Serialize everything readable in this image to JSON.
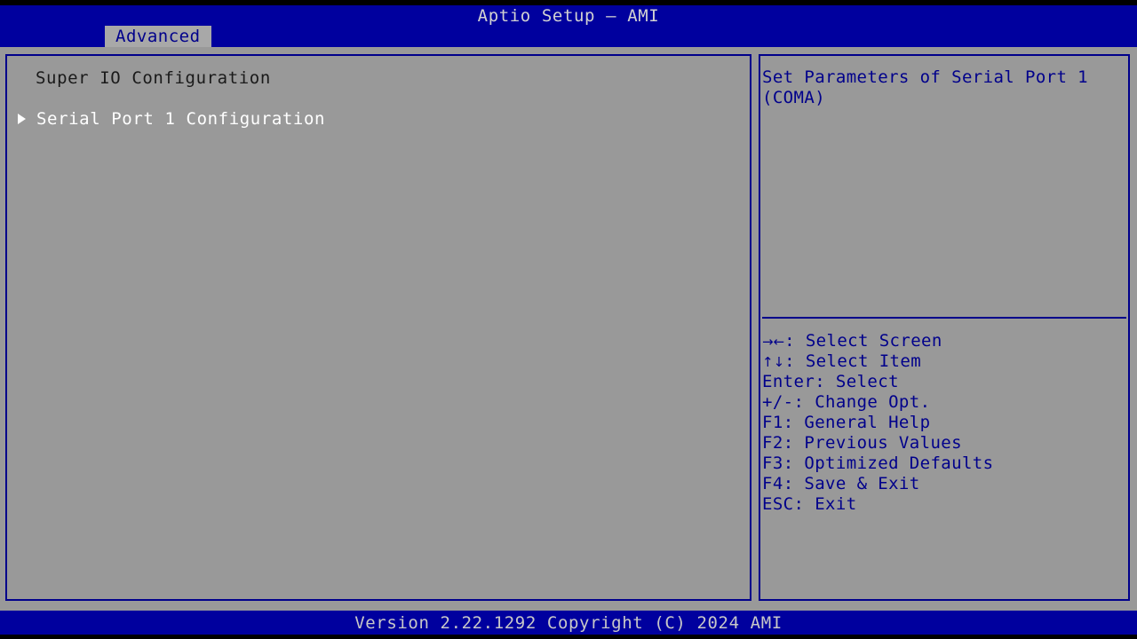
{
  "header": {
    "title": "Aptio Setup – AMI",
    "tabs": [
      {
        "label": "Advanced",
        "active": true
      }
    ]
  },
  "main": {
    "section_heading": "Super IO Configuration",
    "items": [
      {
        "label": "Serial Port 1 Configuration",
        "marker": "submenu-arrow-icon",
        "selected": true
      }
    ]
  },
  "help": {
    "text": "Set Parameters of Serial Port 1 (COMA)"
  },
  "keys": [
    {
      "glyph": "→←",
      "key": "",
      "separator": ": ",
      "action": "Select Screen",
      "line": "→←: Select Screen"
    },
    {
      "glyph": "↑↓",
      "key": "",
      "separator": ": ",
      "action": "Select Item",
      "line": "↑↓: Select Item"
    },
    {
      "glyph": "",
      "key": "Enter",
      "separator": ": ",
      "action": "Select",
      "line": "Enter: Select"
    },
    {
      "glyph": "",
      "key": "+/-",
      "separator": ": ",
      "action": "Change Opt.",
      "line": "+/-: Change Opt."
    },
    {
      "glyph": "",
      "key": "F1",
      "separator": ": ",
      "action": "General Help",
      "line": "F1: General Help"
    },
    {
      "glyph": "",
      "key": "F2",
      "separator": ": ",
      "action": "Previous Values",
      "line": "F2: Previous Values"
    },
    {
      "glyph": "",
      "key": "F3",
      "separator": ": ",
      "action": "Optimized Defaults",
      "line": "F3: Optimized Defaults"
    },
    {
      "glyph": "",
      "key": "F4",
      "separator": ": ",
      "action": "Save & Exit",
      "line": "F4: Save & Exit"
    },
    {
      "glyph": "",
      "key": "ESC",
      "separator": ": ",
      "action": "Exit",
      "line": "ESC: Exit"
    }
  ],
  "footer": {
    "text": "Version 2.22.1292 Copyright (C) 2024 AMI"
  },
  "colors": {
    "header_blue": "#00009e",
    "panel_gray": "#999999",
    "border_blue": "#00008b",
    "help_text_blue": "#00008b",
    "selected_white": "#ffffff",
    "heading_black": "#1a1a1a",
    "tab_gray": "#a8a8a8"
  }
}
